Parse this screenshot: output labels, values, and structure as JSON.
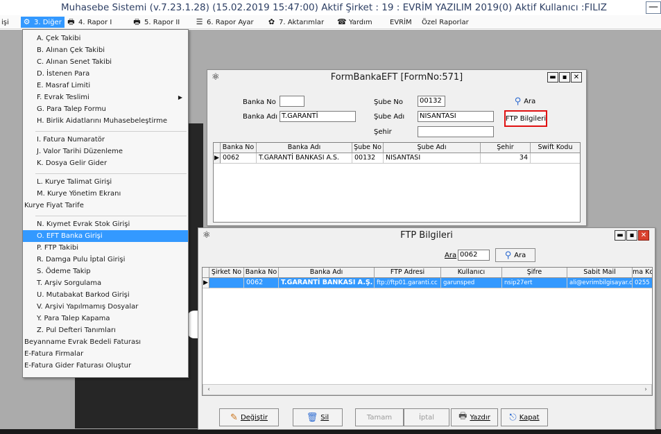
{
  "app": {
    "title": "Muhasebe Sistemi (v.7.23.1.28) (15.02.2019 15:47:00) Aktif Şirket : 19 : EVRİM YAZILIM 2019(0) Aktif Kullanıcı :FILIZ",
    "minimize_glyph": "—"
  },
  "menubar": {
    "items": [
      {
        "label": "işi",
        "icon": ""
      },
      {
        "label": "3. Diğer",
        "icon": "⚙"
      },
      {
        "label": "4. Rapor I",
        "icon": "🖶"
      },
      {
        "label": "5. Rapor II",
        "icon": "🖶"
      },
      {
        "label": "6. Rapor Ayar",
        "icon": "☰"
      },
      {
        "label": "7. Aktarımlar",
        "icon": "✿"
      },
      {
        "label": "Yardım",
        "icon": "☎"
      },
      {
        "label": "EVRİM",
        "icon": ""
      },
      {
        "label": "Özel Raporlar",
        "icon": ""
      }
    ]
  },
  "dropdown": {
    "items": [
      "A. Çek Takibi",
      "B. Alınan Çek Takibi",
      "C. Alınan Senet Takibi",
      "D. İstenen Para",
      "E. Masraf Limiti",
      "F. Evrak Teslimi",
      "G. Para Talep Formu",
      "H. Birlik Aidatlarını Muhasebeleştirme",
      "I. Fatura Numaratör",
      "J. Valor Tarihi Düzenleme",
      "K. Dosya Gelir Gider",
      "L. Kurye Talimat Girişi",
      "M. Kurye Yönetim Ekranı",
      "Kurye Fiyat Tarife",
      "N. Kıymet Evrak Stok Girişi",
      "O. EFT Banka Girişi",
      "P. FTP Takibi",
      "R. Damga Pulu İptal Girişi",
      "S. Ödeme Takip",
      "T. Arşiv Sorgulama",
      "U. Mutabakat Barkod Girişi",
      "V. Arşivi Yapılmamış Dosyalar",
      "Y. Para Talep Kapama",
      "Z. Pul Defteri Tanımları",
      "Beyanname Evrak Bedeli Faturası",
      "E-Fatura Firmalar",
      "E-Fatura Gider Faturası Oluştur"
    ],
    "submenu_arrow": "▶"
  },
  "form_banka": {
    "title": "FormBankaEFT [FormNo:571]",
    "labels": {
      "banka_no": "Banka No",
      "banka_adi": "Banka Adı",
      "sube_no": "Şube No",
      "sube_adi": "Şube Adı",
      "sehir": "Şehir"
    },
    "values": {
      "banka_no": "",
      "banka_adi": "T.GARANTİ",
      "sube_no": "00132",
      "sube_adi": "NISANTASI",
      "sehir": ""
    },
    "ara_label": "Ara",
    "ftp_button": "FTP Bilgileri",
    "grid": {
      "columns": [
        "Banka No",
        "Banka Adı",
        "Şube No",
        "Şube Adı",
        "Şehir",
        "Swift Kodu"
      ],
      "rows": [
        {
          "banka_no": "0062",
          "banka_adi": "T.GARANTİ BANKASI A.S.",
          "sube_no": "00132",
          "sube_adi": "NISANTASI",
          "sehir": "34",
          "swift": ""
        }
      ]
    }
  },
  "form_ftp": {
    "title": "FTP Bilgileri",
    "ara_field_label": "Ara",
    "ara_value": "0062",
    "ara_button": "Ara",
    "grid": {
      "columns": [
        "Şirket No",
        "Banka No",
        "Banka Adı",
        "FTP Adresi",
        "Kullanıcı",
        "Şifre",
        "Sabit Mail",
        "ma Kc"
      ],
      "rows": [
        {
          "sirket_no": "",
          "banka_no": "0062",
          "banka_adi": "T.GARANTİ BANKASI A.Ş.",
          "ftp_adresi": "ftp://ftp01.garanti.cc",
          "kullanici": "garunsped",
          "sifre": "nsip27ert",
          "sabit_mail": "ali@evrimbilgisayar.c",
          "ma_kc": "0255"
        }
      ]
    },
    "buttons": {
      "degistir": "Değiştir",
      "sil": "Sil",
      "tamam": "Tamam",
      "iptal": "İptal",
      "yazdir": "Yazdır",
      "kapat": "Kapat"
    }
  }
}
